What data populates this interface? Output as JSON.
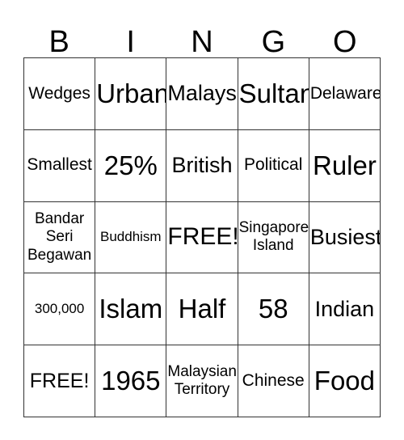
{
  "header": {
    "letters": [
      "B",
      "I",
      "N",
      "G",
      "O"
    ]
  },
  "grid": {
    "rows": [
      [
        {
          "text": "Wedges",
          "size": "fs-s"
        },
        {
          "text": "Urban",
          "size": "fs-xxl"
        },
        {
          "text": "Malays",
          "size": "fs-l"
        },
        {
          "text": "Sultan",
          "size": "fs-xxl"
        },
        {
          "text": "Delaware",
          "size": "fs-s"
        }
      ],
      [
        {
          "text": "Smallest",
          "size": "fs-s"
        },
        {
          "text": "25%",
          "size": "fs-xxl"
        },
        {
          "text": "British",
          "size": "fs-l"
        },
        {
          "text": "Political",
          "size": "fs-s"
        },
        {
          "text": "Ruler",
          "size": "fs-xxl"
        }
      ],
      [
        {
          "text": "Bandar\nSeri\nBegawan",
          "size": "fs-xs",
          "multiline": true
        },
        {
          "text": "Buddhism",
          "size": "fs-xxs"
        },
        {
          "text": "FREE!",
          "size": "fs-xl"
        },
        {
          "text": "Singapore\nIsland",
          "size": "fs-xs",
          "multiline": true
        },
        {
          "text": "Busiest",
          "size": "fs-l"
        }
      ],
      [
        {
          "text": "300,000",
          "size": "fs-xxs"
        },
        {
          "text": "Islam",
          "size": "fs-xxl"
        },
        {
          "text": "Half",
          "size": "fs-xxl"
        },
        {
          "text": "58",
          "size": "fs-xxl"
        },
        {
          "text": "Indian",
          "size": "fs-l"
        }
      ],
      [
        {
          "text": "FREE!",
          "size": "fs-m"
        },
        {
          "text": "1965",
          "size": "fs-xxl"
        },
        {
          "text": "Malaysian\nTerritory",
          "size": "fs-xs",
          "multiline": true
        },
        {
          "text": "Chinese",
          "size": "fs-s"
        },
        {
          "text": "Food",
          "size": "fs-xxl"
        }
      ]
    ]
  },
  "colors": {
    "background": "#ffffff",
    "text": "#000000",
    "border": "#333333"
  }
}
